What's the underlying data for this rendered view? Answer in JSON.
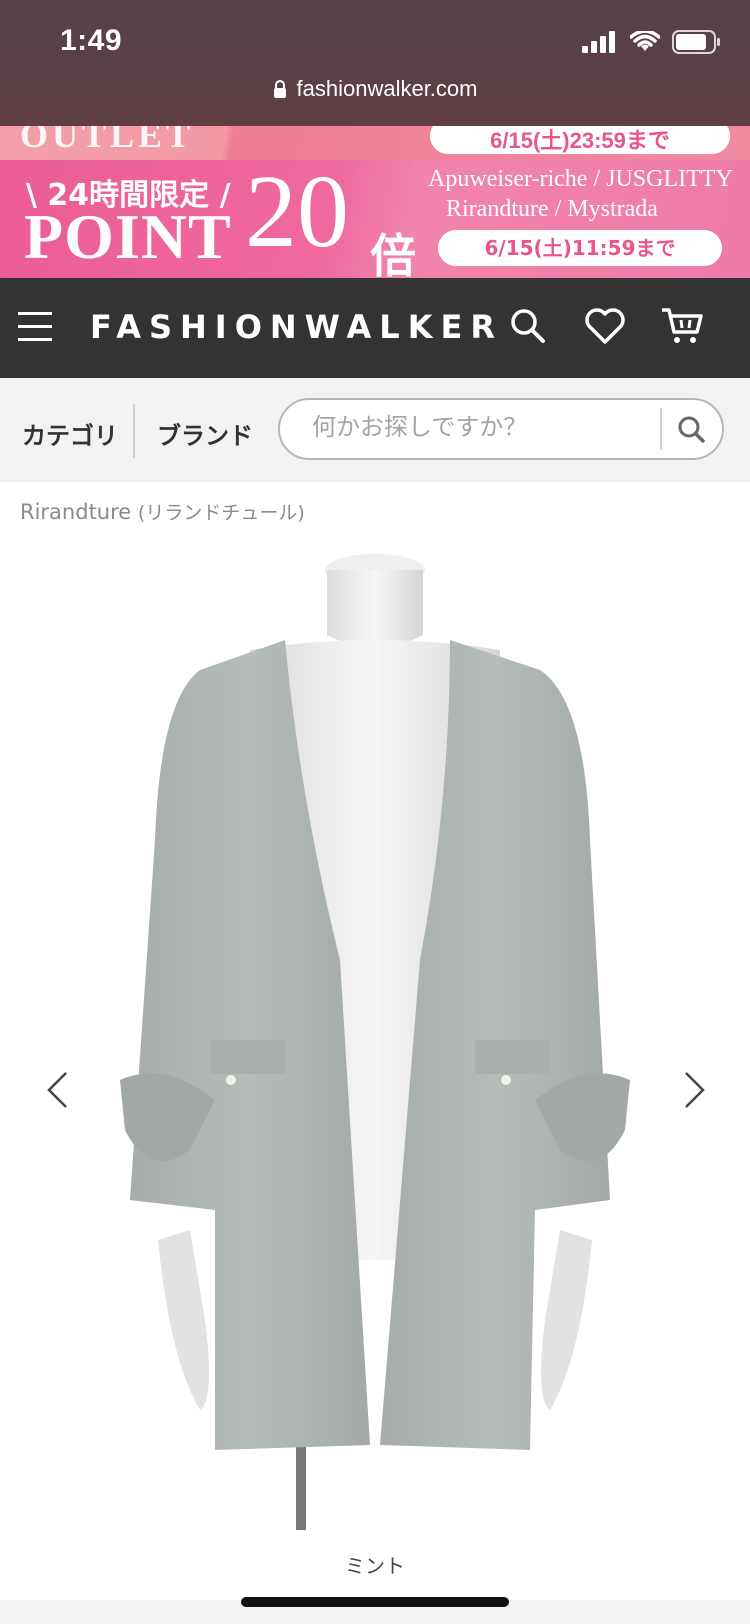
{
  "status_bar": {
    "time": "1:49"
  },
  "browser": {
    "url": "fashionwalker.com"
  },
  "promo": {
    "top_text": "OUTLET",
    "top_pill": "6/15(土)23:59まで",
    "limited": "\\ 24時間限定 /",
    "point": "POINT",
    "multiplier": "20",
    "bai": "倍",
    "brands_line1": "Apuweiser-riche / JUSGLITTY",
    "brands_line2": "Rirandture / Mystrada",
    "deadline": "6/15(土)11:59まで"
  },
  "nav": {
    "logo": "FASHIONWALKER"
  },
  "subnav": {
    "category": "カテゴリ",
    "brand": "ブランド",
    "search_placeholder": "何かお探しですか？"
  },
  "product": {
    "brand_name": "Rirandture",
    "brand_kana": "(リランドチュール)",
    "color": "ミント"
  },
  "icons": [
    "lock-icon",
    "signal-icon",
    "wifi-icon",
    "battery-icon",
    "menu-icon",
    "search-icon",
    "heart-icon",
    "cart-icon",
    "chevron-left-icon",
    "chevron-right-icon"
  ],
  "colors": {
    "nav_bg": "#333333",
    "banner_pink": "#ec5c95",
    "garment": "#aab0ad"
  }
}
